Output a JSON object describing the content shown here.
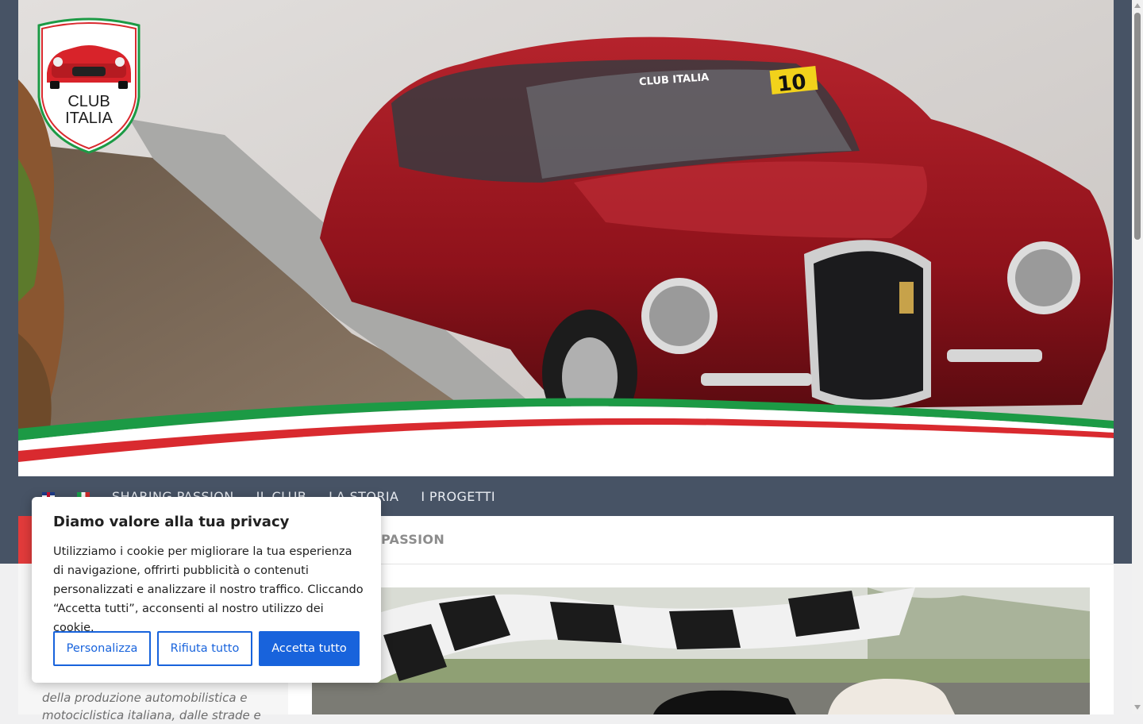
{
  "logo": {
    "line1": "CLUB",
    "line2": "ITALIA"
  },
  "hero": {
    "windshield_text": "CLUB ITALIA",
    "race_number": "10"
  },
  "nav": {
    "items": [
      {
        "label": "SHARING PASSION"
      },
      {
        "label": "IL CLUB"
      },
      {
        "label": "LA STORIA"
      },
      {
        "label": "I PROGETTI"
      }
    ]
  },
  "breadcrumb": {
    "label": "PASSION"
  },
  "sidebar": {
    "text": "della produzione automobilistica e motociclistica italiana, dalle strade e"
  },
  "cookie": {
    "title": "Diamo valore alla tua privacy",
    "body": "Utilizziamo i cookie per migliorare la tua esperienza di navigazione, offrirti pubblicità o contenuti personalizzati e analizzare il nostro traffico. Cliccando “Accetta tutti”, acconsenti al nostro utilizzo dei cookie.",
    "customize_label": "Personalizza",
    "reject_label": "Rifiuta tutto",
    "accept_label": "Accetta tutto"
  },
  "colors": {
    "nav_bg": "#475365",
    "accent_red": "#e23b3b",
    "cookie_blue": "#1863dc"
  }
}
